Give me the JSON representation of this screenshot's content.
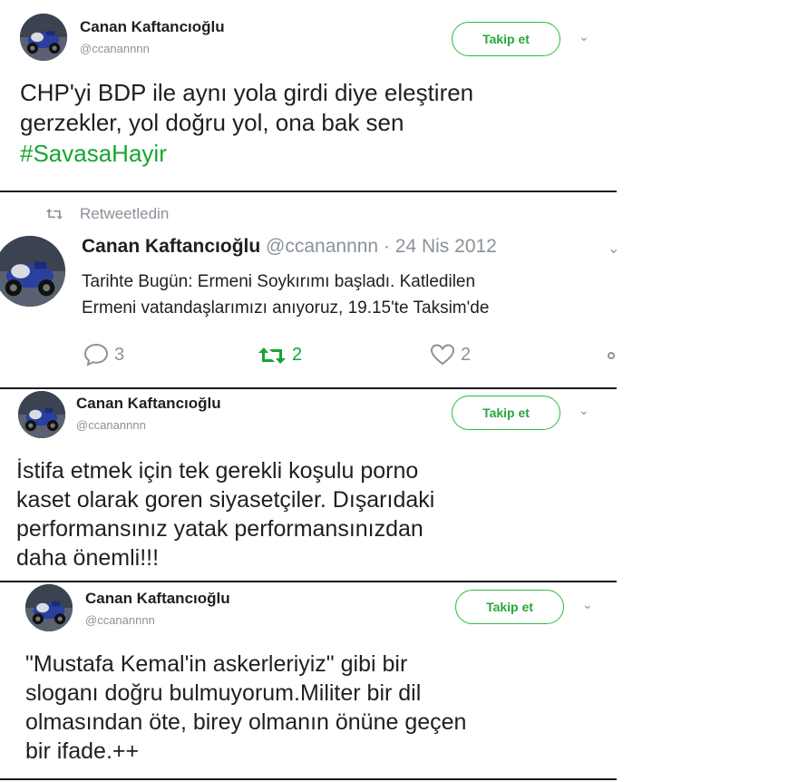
{
  "tweets": [
    {
      "name": "Canan Kaftancıoğlu",
      "handle": "@ccanannnn",
      "follow_label": "Takip et",
      "text_lines": [
        "CHP'yi BDP ile aynı yola girdi diye eleştiren",
        "gerzekler, yol doğru yol, ona bak sen"
      ],
      "hashtag": "#SavasaHayir"
    },
    {
      "retweeted_label": "Retweetledin",
      "name": "Canan Kaftancıoğlu",
      "handle": "@ccanannnn",
      "date": "· 24 Nis 2012",
      "text_lines": [
        "Tarihte Bugün: Ermeni Soykırımı başladı. Katledilen",
        "Ermeni vatandaşlarımızı anıyoruz, 19.15'te Taksim'de"
      ],
      "reply_count": "3",
      "retweet_count": "2",
      "like_count": "2"
    },
    {
      "name": "Canan Kaftancıoğlu",
      "handle": "@ccanannnn",
      "follow_label": "Takip et",
      "text_lines": [
        "İstifa etmek için tek gerekli koşulu porno",
        "kaset olarak goren siyasetçiler. Dışarıdaki",
        "performansınız yatak performansınızdan",
        "daha önemli!!!"
      ]
    },
    {
      "name": "Canan Kaftancıoğlu",
      "handle": "@ccanannnn",
      "follow_label": "Takip et",
      "text_lines": [
        "\"Mustafa Kemal'in askerleriyiz\" gibi bir",
        "sloganı doğru bulmuyorum.Militer bir dil",
        "olmasından öte, birey olmanın önüne geçen",
        "bir ifade.++"
      ]
    }
  ],
  "colors": {
    "accent_green": "#17a532",
    "gray": "#8a9299"
  },
  "icons": [
    "avatar-photo",
    "chevron-down-icon",
    "retweet-icon",
    "reply-icon",
    "like-icon"
  ]
}
